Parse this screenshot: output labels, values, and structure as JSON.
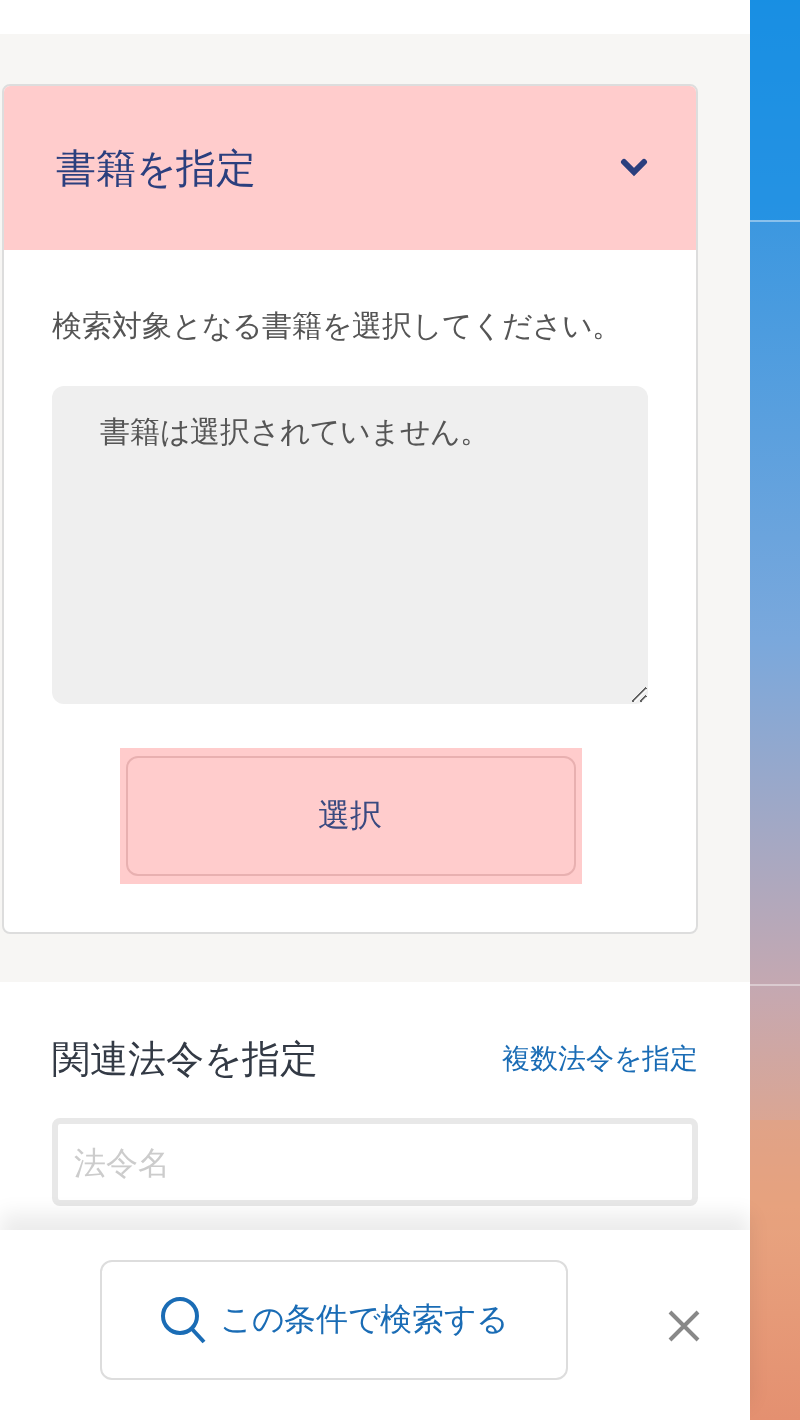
{
  "book_section": {
    "title": "書籍を指定",
    "expanded": true,
    "description": "検索対象となる書籍を選択してください。",
    "selection": "書籍は選択されていません。",
    "select_button": "選択"
  },
  "law_section": {
    "title": "関連法令を指定",
    "multi_link": "複数法令を指定",
    "law_field": {
      "placeholder": "法令名"
    }
  },
  "footer": {
    "search_button": "この条件で検索する"
  }
}
